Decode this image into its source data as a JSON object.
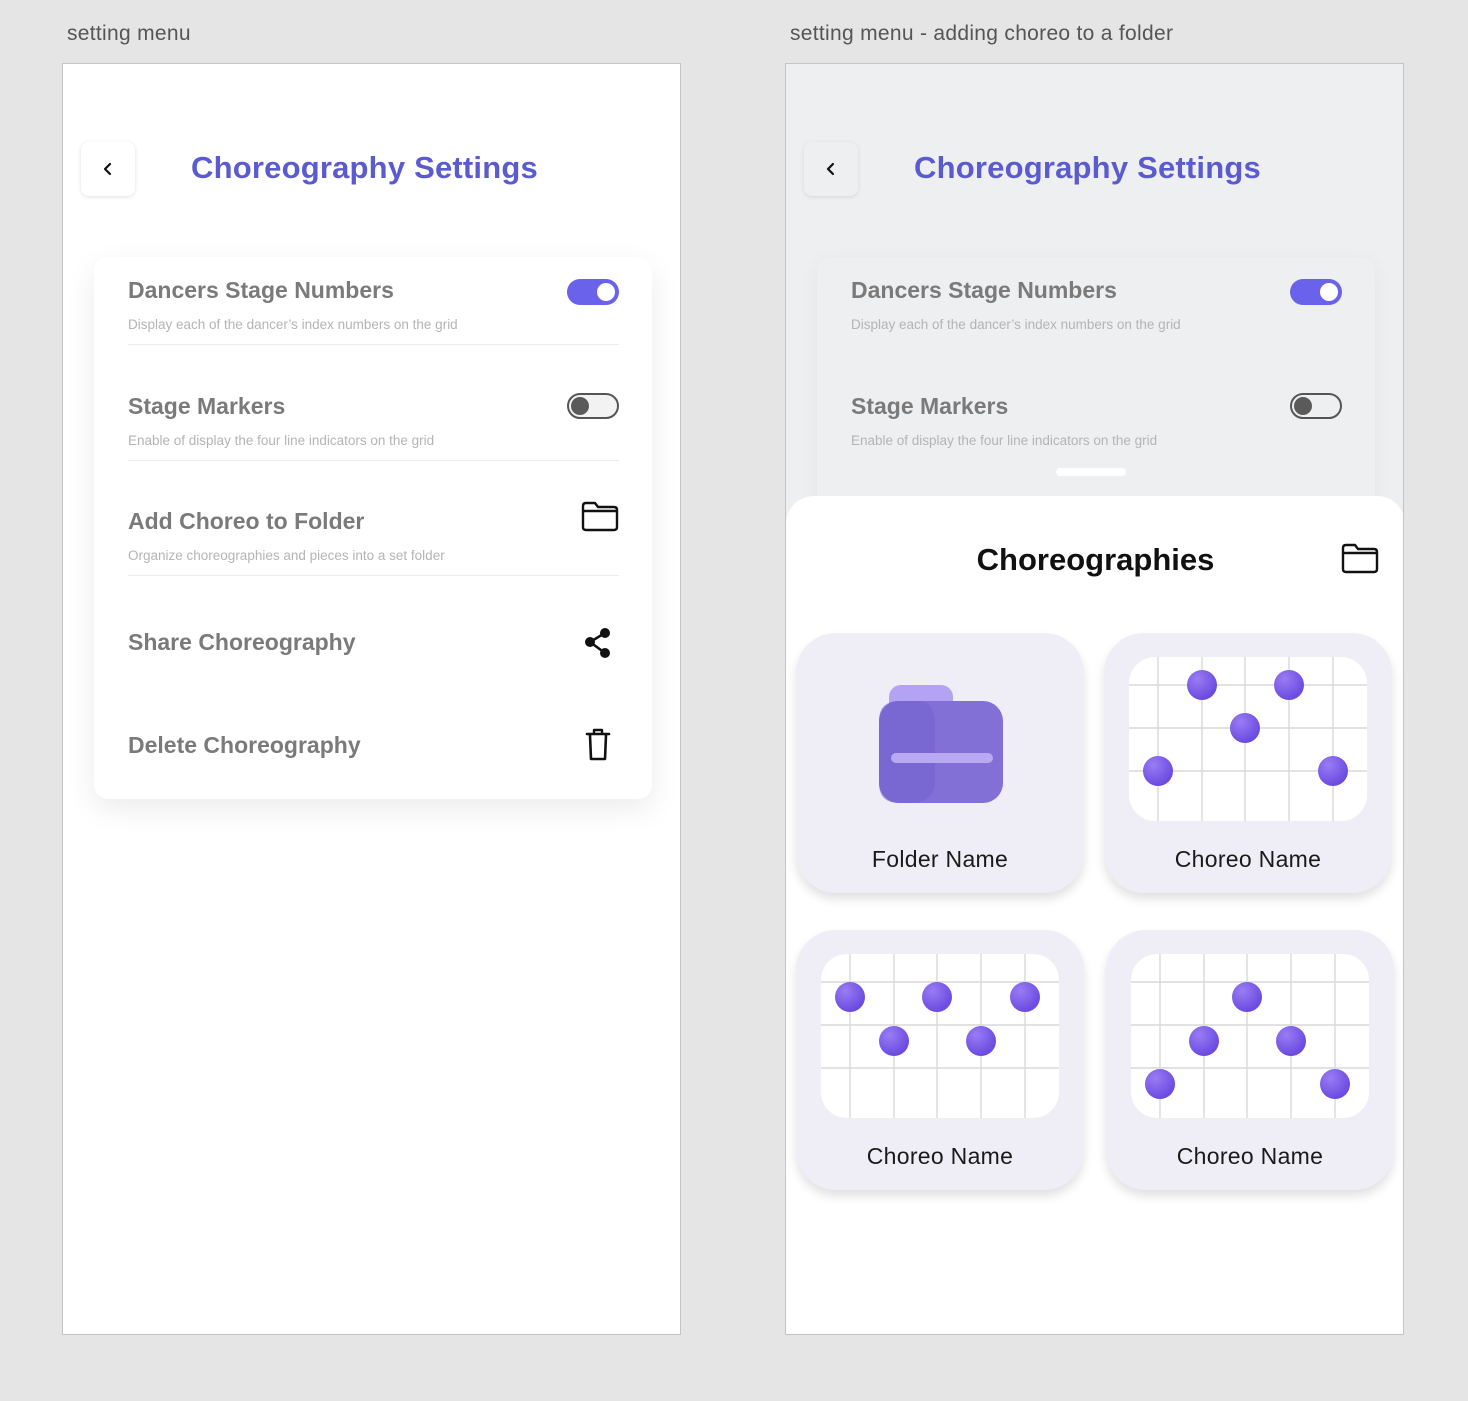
{
  "captions": {
    "left": "setting menu",
    "right": "setting menu - adding choreo to a folder"
  },
  "header": {
    "title": "Choreography Settings",
    "back_icon": "chevron-left-icon"
  },
  "settings": [
    {
      "label": "Dancers Stage Numbers",
      "description": "Display each of the dancer’s index numbers on the grid",
      "control": "toggle",
      "on": true
    },
    {
      "label": "Stage Markers",
      "description": "Enable of display the four line indicators on the grid",
      "control": "toggle",
      "on": false
    },
    {
      "label": "Add Choreo to Folder",
      "description": "Organize choreographies and pieces into a set folder",
      "control": "folder-icon"
    },
    {
      "label": "Share Choreography",
      "description": "",
      "control": "share-icon"
    },
    {
      "label": "Delete Choreography",
      "description": "",
      "control": "trash-icon"
    }
  ],
  "sheet": {
    "title": "Choreographies",
    "folder_icon": "folder-icon",
    "items": [
      {
        "name": "Folder Name",
        "kind": "folder"
      },
      {
        "name": "Choreo Name",
        "kind": "choreo",
        "formation": [
          [
            1,
            0.5
          ],
          [
            3,
            0.5
          ],
          [
            2,
            1.5
          ],
          [
            0,
            2.5
          ],
          [
            4,
            2.5
          ]
        ]
      },
      {
        "name": "Choreo Name",
        "kind": "choreo",
        "formation": [
          [
            0,
            1
          ],
          [
            2,
            1
          ],
          [
            4,
            1
          ],
          [
            1,
            2
          ],
          [
            3,
            2
          ]
        ]
      },
      {
        "name": "Choreo Name",
        "kind": "choreo",
        "formation": [
          [
            2,
            1
          ],
          [
            1,
            2
          ],
          [
            3,
            2
          ],
          [
            0,
            3
          ],
          [
            4,
            3
          ]
        ]
      }
    ]
  },
  "colors": {
    "accent": "#5b5bd0",
    "toggle_on": "#6a62ea",
    "dot": "#6a4ae0",
    "tile_bg": "#efedf6"
  }
}
